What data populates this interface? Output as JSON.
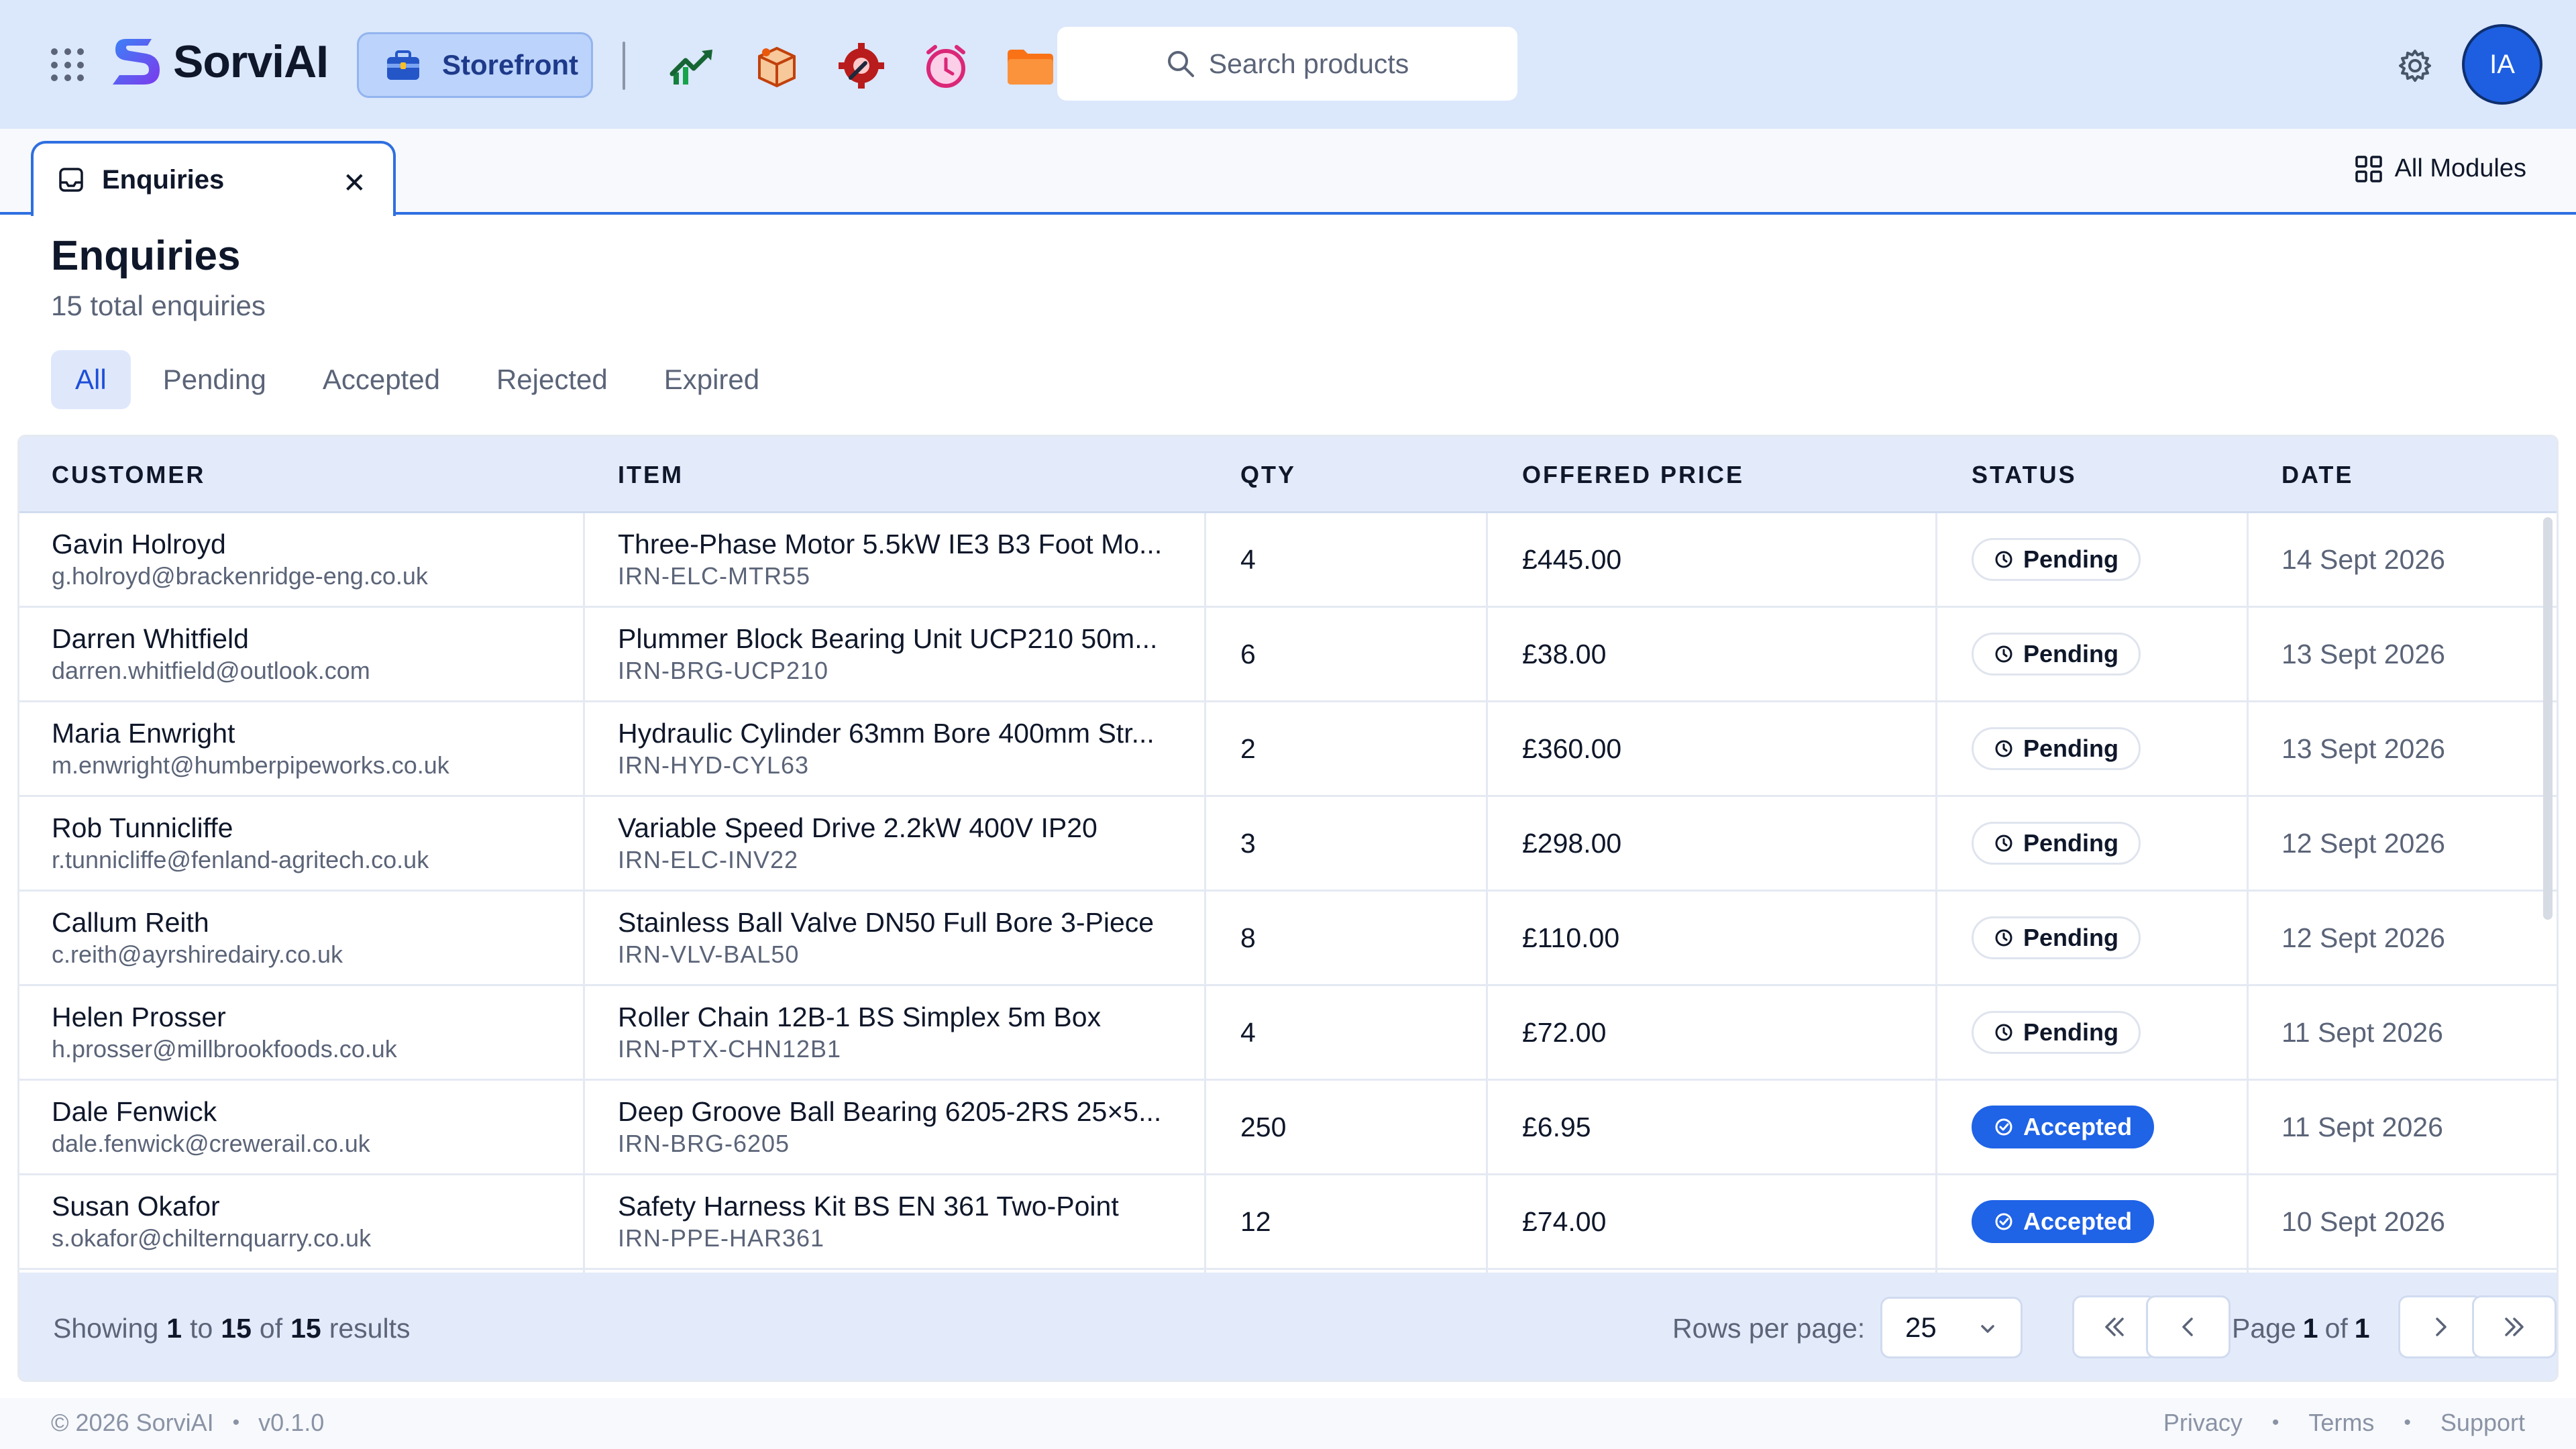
{
  "header": {
    "app_name": "SorviAI",
    "storefront_label": "Storefront",
    "search_placeholder": "Search products",
    "avatar_initials": "IA",
    "app_icons": [
      "trending-chart-icon",
      "box-package-icon",
      "gear-wrench-icon",
      "alarm-clock-icon",
      "folder-icon"
    ]
  },
  "tabs": {
    "active_label": "Enquiries",
    "all_modules_label": "All Modules"
  },
  "page": {
    "title": "Enquiries",
    "subtitle": "15 total enquiries"
  },
  "filters": [
    "All",
    "Pending",
    "Accepted",
    "Rejected",
    "Expired"
  ],
  "active_filter": "All",
  "table": {
    "columns": [
      "CUSTOMER",
      "ITEM",
      "QTY",
      "OFFERED PRICE",
      "STATUS",
      "DATE"
    ],
    "rows": [
      {
        "name": "Gavin Holroyd",
        "email": "g.holroyd@brackenridge-eng.co.uk",
        "item": "Three-Phase Motor 5.5kW IE3 B3 Foot Mo...",
        "sku": "IRN-ELC-MTR55",
        "qty": "4",
        "price": "£445.00",
        "status": "Pending",
        "date": "14 Sept 2026"
      },
      {
        "name": "Darren Whitfield",
        "email": "darren.whitfield@outlook.com",
        "item": "Plummer Block Bearing Unit UCP210 50m...",
        "sku": "IRN-BRG-UCP210",
        "qty": "6",
        "price": "£38.00",
        "status": "Pending",
        "date": "13 Sept 2026"
      },
      {
        "name": "Maria Enwright",
        "email": "m.enwright@humberpipeworks.co.uk",
        "item": "Hydraulic Cylinder 63mm Bore 400mm Str...",
        "sku": "IRN-HYD-CYL63",
        "qty": "2",
        "price": "£360.00",
        "status": "Pending",
        "date": "13 Sept 2026"
      },
      {
        "name": "Rob Tunnicliffe",
        "email": "r.tunnicliffe@fenland-agritech.co.uk",
        "item": "Variable Speed Drive 2.2kW 400V IP20",
        "sku": "IRN-ELC-INV22",
        "qty": "3",
        "price": "£298.00",
        "status": "Pending",
        "date": "12 Sept 2026"
      },
      {
        "name": "Callum Reith",
        "email": "c.reith@ayrshiredairy.co.uk",
        "item": "Stainless Ball Valve DN50 Full Bore 3-Piece",
        "sku": "IRN-VLV-BAL50",
        "qty": "8",
        "price": "£110.00",
        "status": "Pending",
        "date": "12 Sept 2026"
      },
      {
        "name": "Helen Prosser",
        "email": "h.prosser@millbrookfoods.co.uk",
        "item": "Roller Chain 12B-1 BS Simplex 5m Box",
        "sku": "IRN-PTX-CHN12B1",
        "qty": "4",
        "price": "£72.00",
        "status": "Pending",
        "date": "11 Sept 2026"
      },
      {
        "name": "Dale Fenwick",
        "email": "dale.fenwick@crewerail.co.uk",
        "item": "Deep Groove Ball Bearing 6205-2RS 25×5...",
        "sku": "IRN-BRG-6205",
        "qty": "250",
        "price": "£6.95",
        "status": "Accepted",
        "date": "11 Sept 2026"
      },
      {
        "name": "Susan Okafor",
        "email": "s.okafor@chilternquarry.co.uk",
        "item": "Safety Harness Kit BS EN 361 Two-Point",
        "sku": "IRN-PPE-HAR361",
        "qty": "12",
        "price": "£74.00",
        "status": "Accepted",
        "date": "10 Sept 2026"
      }
    ]
  },
  "pagination": {
    "showing_prefix": "Showing",
    "from": "1",
    "to_word": "to",
    "to": "15",
    "of_word": "of",
    "total": "15",
    "results_word": "results",
    "rows_per_page_label": "Rows per page:",
    "rows_per_page_value": "25",
    "page_word": "Page",
    "current_page": "1",
    "page_of_word": "of",
    "total_pages": "1"
  },
  "footer": {
    "copyright": "© 2026 SorviAI",
    "version": "v0.1.0",
    "links": [
      "Privacy",
      "Terms",
      "Support"
    ]
  },
  "colors": {
    "accent": "#1f63e6",
    "header_bg": "#dbe7fb",
    "table_header_bg": "#e3ebfa"
  }
}
